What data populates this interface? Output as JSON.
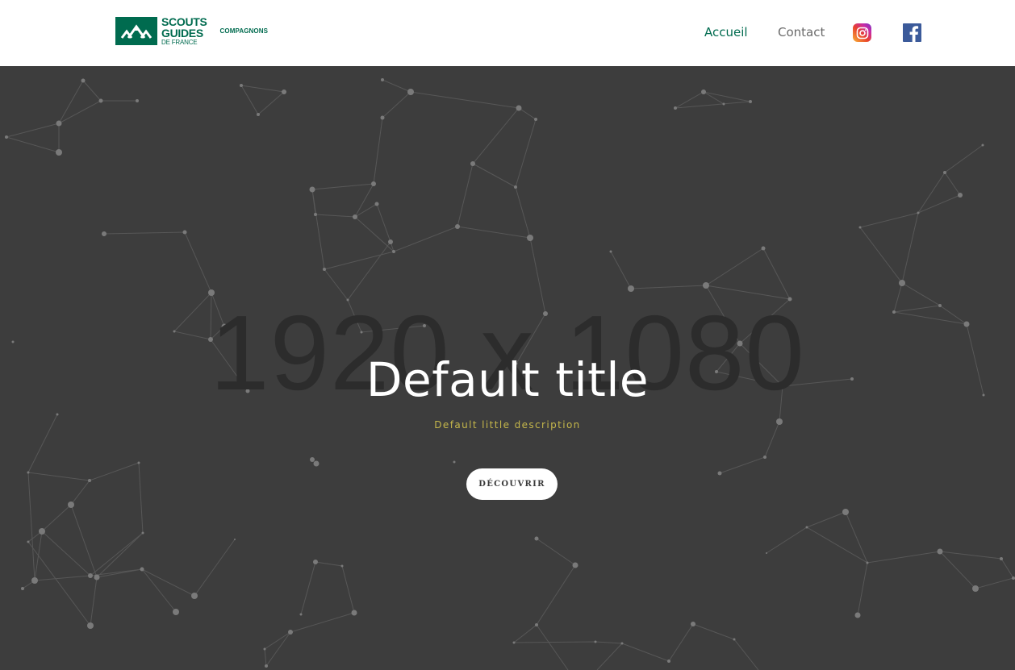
{
  "header": {
    "logo": {
      "line1": "SCOUTS",
      "line2": "GUIDES",
      "line3": "DE FRANCE",
      "subtitle": "COMPAGNONS",
      "color": "#006b4f"
    },
    "nav": [
      {
        "label": "Accueil",
        "active": true
      },
      {
        "label": "Contact",
        "active": false
      }
    ],
    "social": [
      {
        "icon": "instagram-icon"
      },
      {
        "icon": "facebook-icon"
      }
    ]
  },
  "hero": {
    "placeholder_size": "1920 x 1080",
    "title": "Default title",
    "description": "Default little description",
    "button_label": "DÉCOUVRIR",
    "background_color": "#3d3d3d",
    "description_color": "#c5b74b"
  }
}
